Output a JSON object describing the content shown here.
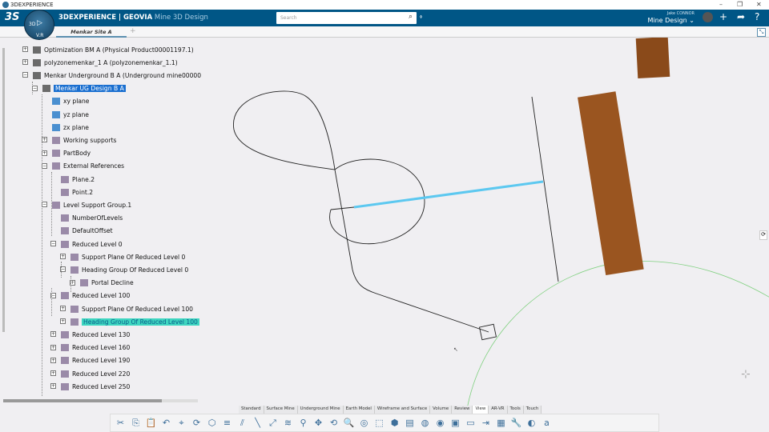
{
  "window": {
    "title": "3DEXPERIENCE",
    "min": "–",
    "max": "❐",
    "close": "✕"
  },
  "header": {
    "brand": "3DEXPERIENCE | GEOVIA",
    "app": "Mine 3D Design",
    "search_placeholder": "Search",
    "user": "Jake CONNOR",
    "role": "Mine Design ⌄",
    "compass_labels": [
      "3D",
      "V.R"
    ]
  },
  "tabs": [
    {
      "label": "Menkar Site A"
    }
  ],
  "tree": [
    {
      "label": "Optimization BM A (Physical Product00001197.1)",
      "level": 0,
      "expander": "+"
    },
    {
      "label": "polyzonemenkar_1 A (polyzonemenkar_1.1)",
      "level": 0,
      "expander": "+"
    },
    {
      "label": "Menkar Underground B A (Underground mine00000",
      "level": 0,
      "expander": "−"
    },
    {
      "label": "Menkar UG Design B A",
      "level": 1,
      "expander": "−",
      "state": "selected"
    },
    {
      "label": "xy plane",
      "level": 2
    },
    {
      "label": "yz plane",
      "level": 2
    },
    {
      "label": "zx plane",
      "level": 2
    },
    {
      "label": "Working supports",
      "level": 2,
      "expander": "+"
    },
    {
      "label": "PartBody",
      "level": 2,
      "expander": "+"
    },
    {
      "label": "External References",
      "level": 2,
      "expander": "−"
    },
    {
      "label": "Plane.2",
      "level": 3
    },
    {
      "label": "Point.2",
      "level": 3
    },
    {
      "label": "Level Support Group.1",
      "level": 2,
      "expander": "−"
    },
    {
      "label": "NumberOfLevels",
      "level": 3
    },
    {
      "label": "DefaultOffset",
      "level": 3
    },
    {
      "label": "Reduced Level 0",
      "level": 3,
      "expander": "−"
    },
    {
      "label": "Support Plane Of Reduced Level 0",
      "level": 4,
      "expander": "+"
    },
    {
      "label": "Heading Group Of Reduced Level 0",
      "level": 4,
      "expander": "−"
    },
    {
      "label": "Portal Decline",
      "level": 5,
      "expander": "+"
    },
    {
      "label": "Reduced Level 100",
      "level": 3,
      "expander": "−"
    },
    {
      "label": "Support Plane Of Reduced Level 100",
      "level": 4,
      "expander": "+"
    },
    {
      "label": "Heading Group Of Reduced Level 100",
      "level": 4,
      "expander": "+",
      "state": "highlighted"
    },
    {
      "label": "Reduced Level 130",
      "level": 3,
      "expander": "+"
    },
    {
      "label": "Reduced Level 160",
      "level": 3,
      "expander": "+"
    },
    {
      "label": "Reduced Level 190",
      "level": 3,
      "expander": "+"
    },
    {
      "label": "Reduced Level 220",
      "level": 3,
      "expander": "+"
    },
    {
      "label": "Reduced Level 250",
      "level": 3,
      "expander": "+"
    }
  ],
  "action_bar_tabs": [
    {
      "label": "Standard"
    },
    {
      "label": "Surface Mine"
    },
    {
      "label": "Underground Mine"
    },
    {
      "label": "Earth Model"
    },
    {
      "label": "Wireframe and Surface"
    },
    {
      "label": "Volume"
    },
    {
      "label": "Review"
    },
    {
      "label": "View",
      "active": true
    },
    {
      "label": "AR-VR"
    },
    {
      "label": "Tools"
    },
    {
      "label": "Touch"
    }
  ],
  "action_bar_icons": [
    "cut-icon",
    "copy-icon",
    "paste-icon",
    "undo-icon",
    "fit-all-icon",
    "update-icon",
    "select-icon",
    "level-icon",
    "heading-icon",
    "drive-icon",
    "junction-icon",
    "ramp-icon",
    "zoom-icon",
    "pan-icon",
    "rotate-icon",
    "zoom-area-icon",
    "capture-icon",
    "view-box-icon",
    "shading-icon",
    "database-icon",
    "globe-settings-icon",
    "web-icon",
    "select-3d-icon",
    "display-icon",
    "export-icon",
    "data-icon",
    "wrench-icon",
    "globe-icon",
    "spell-icon"
  ],
  "colors": {
    "header": "#005686",
    "selection": "#1a6fd0",
    "highlight": "#3ed6c0",
    "heading_line": "#5cc8f0",
    "orebody": "#8a4a1a"
  }
}
